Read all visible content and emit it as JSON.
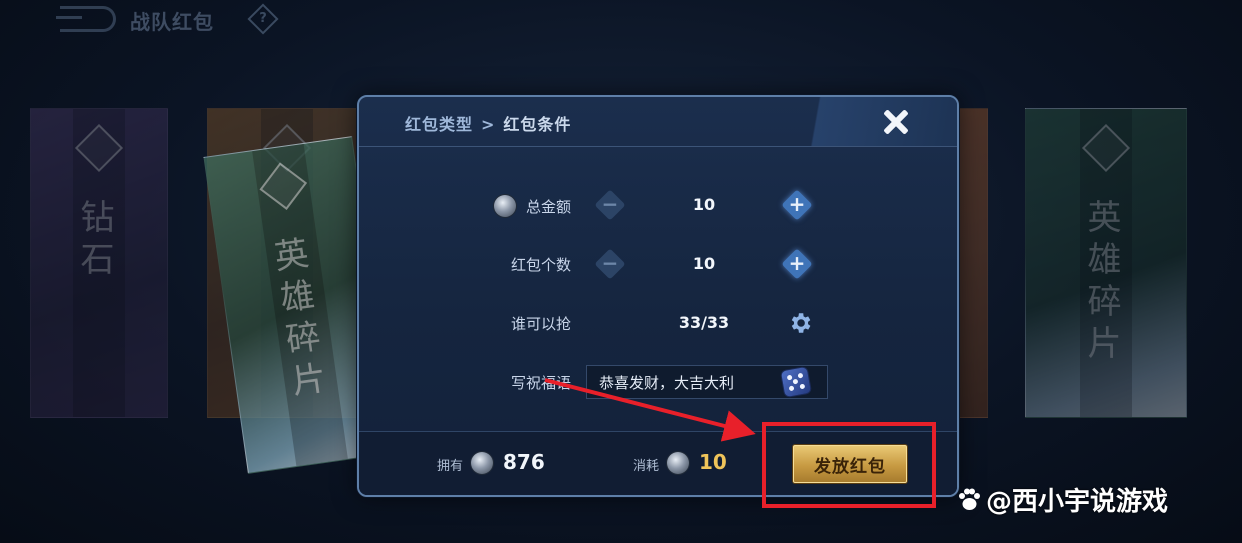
{
  "header": {
    "title": "战队红包",
    "help_symbol": "?"
  },
  "background_envelopes": [
    {
      "name": "purple",
      "text": "钻石"
    },
    {
      "name": "green-front",
      "text": "英雄碎片"
    },
    {
      "name": "green-right",
      "text": "英雄碎片"
    }
  ],
  "dialog": {
    "breadcrumb": {
      "step1": "红包类型",
      "separator": ">",
      "step2": "红包条件"
    },
    "rows": {
      "total_amount": {
        "label": "总金额",
        "value": "10",
        "minus": "−",
        "plus": "+"
      },
      "packet_count": {
        "label": "红包个数",
        "value": "10",
        "minus": "−",
        "plus": "+"
      },
      "who_can_grab": {
        "label": "谁可以抢",
        "value": "33/33"
      },
      "blessing": {
        "label": "写祝福语",
        "value": "恭喜发财，大吉大利"
      }
    },
    "footer": {
      "owned_label": "拥有",
      "owned_value": "876",
      "cost_label": "消耗",
      "cost_value": "10",
      "send_button": "发放红包"
    }
  },
  "watermark": "@西小宇说游戏",
  "colors": {
    "accent_gold": "#f0c45a",
    "annotation_red": "#e8202a",
    "dialog_border": "#5e7fa8"
  },
  "icons": [
    "back-icon",
    "help-icon",
    "close-icon",
    "coin-icon",
    "minus-icon",
    "plus-icon",
    "gear-icon",
    "dice-icon",
    "paw-icon"
  ]
}
